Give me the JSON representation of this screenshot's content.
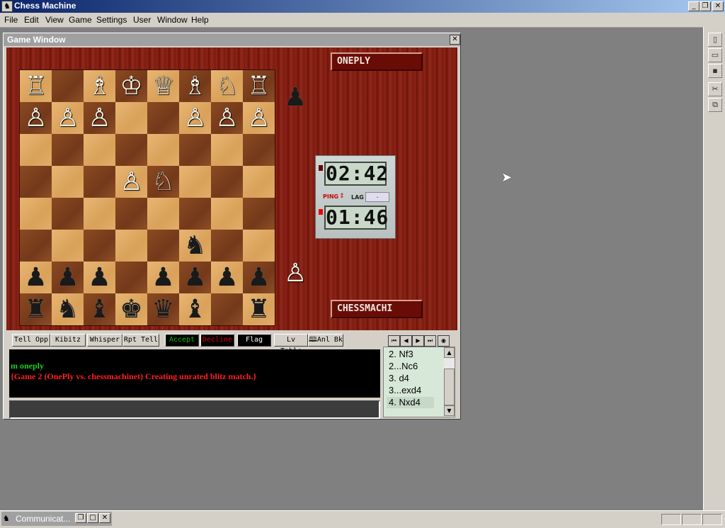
{
  "app": {
    "title": "Chess Machine"
  },
  "menu": {
    "items": [
      "File",
      "Edit",
      "View",
      "Game",
      "Settings",
      "User",
      "Window",
      "Help"
    ]
  },
  "game_window": {
    "title": "Game Window",
    "players": {
      "top": "ONEPLY",
      "bottom": "CHESSMACHI"
    },
    "clock": {
      "top_time": "02:42",
      "bottom_time": "01:46",
      "ping_label": "PING",
      "lag_label": "LAG",
      "lag_value": "."
    },
    "board": [
      [
        "wR",
        "",
        "wB",
        "wK",
        "wQ",
        "wB",
        "wN",
        "wR"
      ],
      [
        "wP",
        "wP",
        "wP",
        "",
        "",
        "wP",
        "wP",
        "wP"
      ],
      [
        "",
        "",
        "",
        "",
        "",
        "",
        "",
        ""
      ],
      [
        "",
        "",
        "",
        "wP",
        "wN",
        "",
        "",
        ""
      ],
      [
        "",
        "",
        "",
        "",
        "",
        "",
        "",
        ""
      ],
      [
        "",
        "",
        "",
        "",
        "",
        "bN",
        "",
        ""
      ],
      [
        "bP",
        "bP",
        "bP",
        "",
        "bP",
        "bP",
        "bP",
        "bP"
      ],
      [
        "bR",
        "bN",
        "bB",
        "bK",
        "bQ",
        "bB",
        "",
        "bR"
      ]
    ],
    "captured": {
      "top": "♟",
      "bottom": "♙"
    }
  },
  "chat": {
    "buttons": [
      "Tell Opp",
      "Kibitz",
      "Whisper",
      "Rpt Tell",
      "Accept",
      "Decline",
      "Flag",
      "Lv Table",
      "Anl Bk"
    ],
    "lines": [
      {
        "text": "m oneply",
        "color": "#22cc22"
      },
      {
        "text": "{Game 2 (OnePly vs. chessmachinet) Creating unrated blitz match.}",
        "color": "#ff2020"
      }
    ],
    "input_value": ""
  },
  "moves": [
    "2.  Nf3",
    "2...Nc6",
    "3.  d4",
    "3...exd4",
    "4.  Nxd4"
  ],
  "taskbar": {
    "label": "Communicat..."
  },
  "colors": {
    "accept": "#00c000",
    "decline": "#e00000",
    "flag": "#ffffff"
  }
}
